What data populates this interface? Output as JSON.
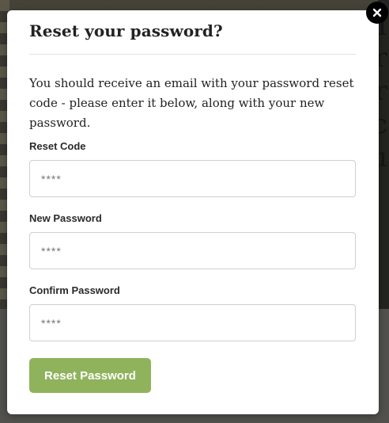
{
  "modal": {
    "title": "Reset your password?",
    "intro": "You should receive an email with your password reset code - please enter it below, along with your new password.",
    "close_icon": "close-icon"
  },
  "form": {
    "fields": [
      {
        "label": "Reset Code",
        "placeholder": "****"
      },
      {
        "label": "New Password",
        "placeholder": "****"
      },
      {
        "label": "Confirm Password",
        "placeholder": "****"
      }
    ],
    "submit_label": "Reset Password"
  },
  "colors": {
    "accent": "#8fb35c",
    "close_background": "#000000"
  }
}
